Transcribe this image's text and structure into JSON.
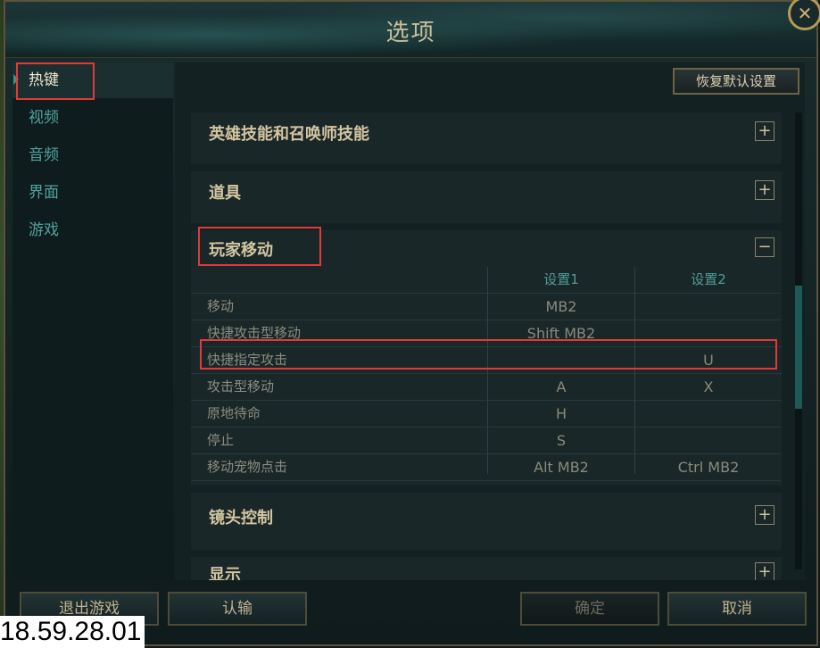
{
  "window": {
    "title": "选项",
    "close_icon": "close-icon"
  },
  "sidebar": {
    "items": [
      {
        "label": "热键",
        "active": true
      },
      {
        "label": "视频"
      },
      {
        "label": "音频"
      },
      {
        "label": "界面"
      },
      {
        "label": "游戏"
      }
    ]
  },
  "toolbar": {
    "reset_label": "恢复默认设置"
  },
  "sections": {
    "abilities": {
      "title": "英雄技能和召唤师技能",
      "toggle": "+"
    },
    "items": {
      "title": "道具",
      "toggle": "+"
    },
    "movement": {
      "title": "玩家移动",
      "toggle": "−"
    },
    "camera": {
      "title": "镜头控制",
      "toggle": "+"
    },
    "display": {
      "title": "显示",
      "toggle": "+"
    }
  },
  "table": {
    "headers": [
      "",
      "设置1",
      "设置2"
    ],
    "rows": [
      {
        "name": "移动",
        "k1": "MB2",
        "k2": ""
      },
      {
        "name": "快捷攻击型移动",
        "k1": "Shift MB2",
        "k2": ""
      },
      {
        "name": "快捷指定攻击",
        "k1": "",
        "k2": "U"
      },
      {
        "name": "攻击型移动",
        "k1": "A",
        "k2": "X"
      },
      {
        "name": "原地待命",
        "k1": "H",
        "k2": ""
      },
      {
        "name": "停止",
        "k1": "S",
        "k2": ""
      },
      {
        "name": "移动宠物点击",
        "k1": "Alt MB2",
        "k2": "Ctrl MB2"
      }
    ]
  },
  "footer": {
    "exit_label": "退出游戏",
    "surrender_label": "认输",
    "ok_label": "确定",
    "cancel_label": "取消"
  },
  "overlay": {
    "timestamp": "18.59.28.01"
  },
  "colors": {
    "accent": "#4fa3a0",
    "highlight": "#e23a3a",
    "gold": "#b59b57"
  }
}
